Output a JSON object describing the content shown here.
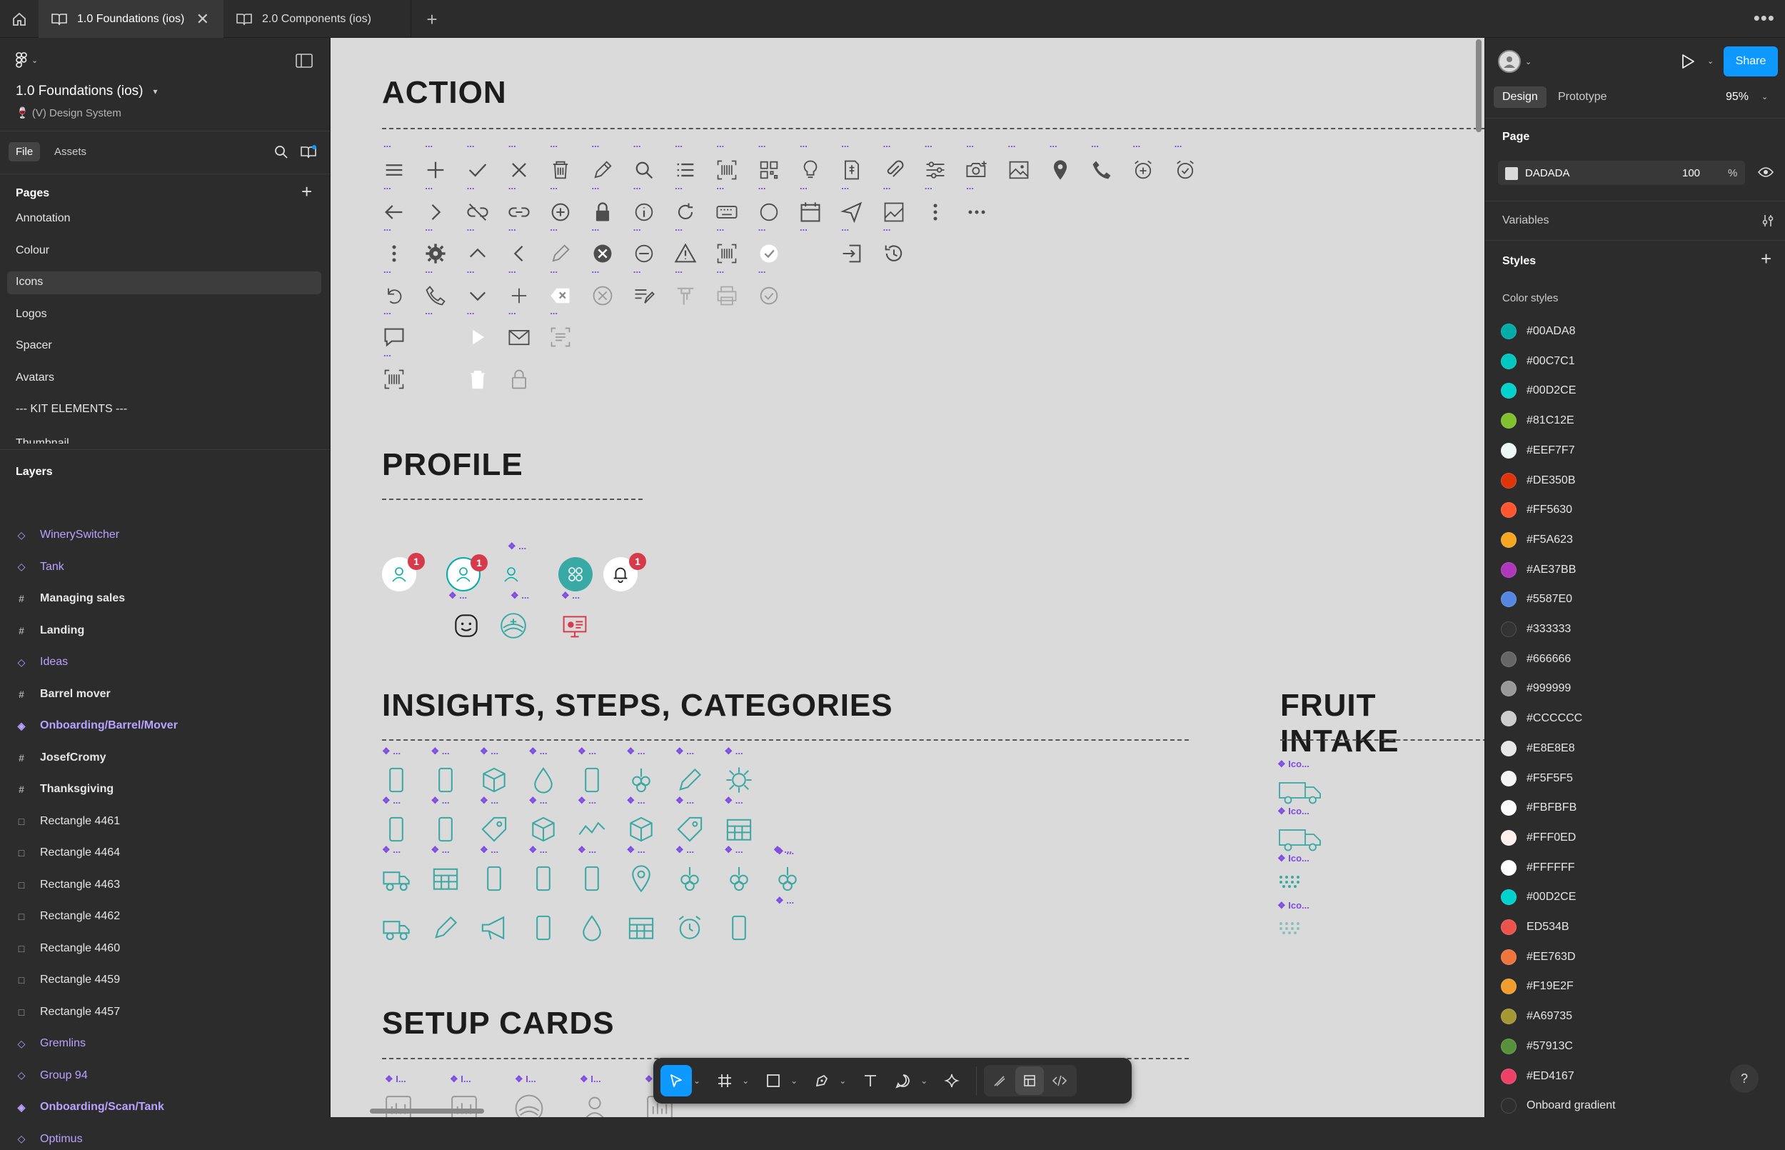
{
  "tabs": [
    {
      "label": "1.0 Foundations (ios)",
      "active": true
    },
    {
      "label": "2.0 Components (ios)",
      "active": false
    }
  ],
  "file": {
    "title": "1.0 Foundations (ios)",
    "project": "🍷 (V) Design System",
    "tab_file": "File",
    "tab_assets": "Assets"
  },
  "pages": {
    "heading": "Pages",
    "items": [
      "Annotation",
      "Colour",
      "Icons",
      "Logos",
      "Spacer",
      "Avatars",
      "--- KIT ELEMENTS ---",
      "Thumbnail"
    ],
    "selected": "Icons"
  },
  "layers": {
    "heading": "Layers",
    "items": [
      {
        "label": "WinerySwitcher",
        "type": "component"
      },
      {
        "label": "Tank",
        "type": "component"
      },
      {
        "label": "Managing sales",
        "type": "frame"
      },
      {
        "label": "Landing",
        "type": "frame"
      },
      {
        "label": "Ideas",
        "type": "component"
      },
      {
        "label": "Barrel mover",
        "type": "frame"
      },
      {
        "label": "Onboarding/Barrel/Mover",
        "type": "instance"
      },
      {
        "label": "JosefCromy",
        "type": "frame"
      },
      {
        "label": "Thanksgiving",
        "type": "frame"
      },
      {
        "label": "Rectangle 4461",
        "type": "rect"
      },
      {
        "label": "Rectangle 4464",
        "type": "rect"
      },
      {
        "label": "Rectangle 4463",
        "type": "rect"
      },
      {
        "label": "Rectangle 4462",
        "type": "rect"
      },
      {
        "label": "Rectangle 4460",
        "type": "rect"
      },
      {
        "label": "Rectangle 4459",
        "type": "rect"
      },
      {
        "label": "Rectangle 4457",
        "type": "rect"
      },
      {
        "label": "Gremlins",
        "type": "component"
      },
      {
        "label": "Group 94",
        "type": "component"
      },
      {
        "label": "Onboarding/Scan/Tank",
        "type": "instance"
      },
      {
        "label": "Optimus",
        "type": "component"
      }
    ]
  },
  "canvas": {
    "sections": {
      "action": "ACTION",
      "profile": "PROFILE",
      "insights": "INSIGHTS, STEPS, CATEGORIES",
      "fruit": "FRUIT INTAKE",
      "setup": "SETUP CARDS"
    },
    "small_label": "...",
    "comp_label": "❖ ...",
    "fruit_label": "❖ Ico...",
    "setup_label": "❖ I...",
    "badge": "1"
  },
  "right": {
    "share": "Share",
    "tab_design": "Design",
    "tab_prototype": "Prototype",
    "zoom": "95%",
    "page_heading": "Page",
    "page_color": "DADADA",
    "page_opacity": "100",
    "page_pct": "%",
    "variables": "Variables",
    "styles": "Styles",
    "color_styles": "Color styles",
    "colors": [
      {
        "name": "#00ADA8",
        "hex": "#00ADA8"
      },
      {
        "name": "#00C7C1",
        "hex": "#00C7C1"
      },
      {
        "name": "#00D2CE",
        "hex": "#00D2CE"
      },
      {
        "name": "#81C12E",
        "hex": "#81C12E"
      },
      {
        "name": "#EEF7F7",
        "hex": "#EEF7F7"
      },
      {
        "name": "#DE350B",
        "hex": "#DE350B"
      },
      {
        "name": "#FF5630",
        "hex": "#FF5630"
      },
      {
        "name": "#F5A623",
        "hex": "#F5A623"
      },
      {
        "name": "#AE37BB",
        "hex": "#AE37BB"
      },
      {
        "name": "#5587E0",
        "hex": "#5587E0"
      },
      {
        "name": "#333333",
        "hex": "#333333"
      },
      {
        "name": "#666666",
        "hex": "#666666"
      },
      {
        "name": "#999999",
        "hex": "#999999"
      },
      {
        "name": "#CCCCCC",
        "hex": "#CCCCCC"
      },
      {
        "name": "#E8E8E8",
        "hex": "#E8E8E8"
      },
      {
        "name": "#F5F5F5",
        "hex": "#F5F5F5"
      },
      {
        "name": "#FBFBFB",
        "hex": "#FBFBFB"
      },
      {
        "name": "#FFF0ED",
        "hex": "#FFF0ED"
      },
      {
        "name": "#FFFFFF",
        "hex": "#FFFFFF"
      },
      {
        "name": "#00D2CE",
        "hex": "#00D2CE"
      },
      {
        "name": "ED534B",
        "hex": "#ED534B"
      },
      {
        "name": "#EE763D",
        "hex": "#EE763D"
      },
      {
        "name": "#F19E2F",
        "hex": "#F19E2F"
      },
      {
        "name": "#A69735",
        "hex": "#A69735"
      },
      {
        "name": "#57913C",
        "hex": "#57913C"
      },
      {
        "name": "#ED4167",
        "hex": "#ED4167"
      },
      {
        "name": "Onboard gradient",
        "hex": "#2e2e2e"
      }
    ]
  },
  "help": "?"
}
